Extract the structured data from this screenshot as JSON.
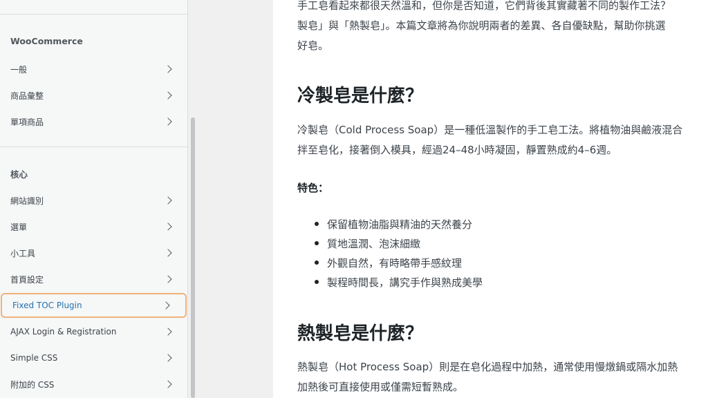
{
  "sidebar": {
    "section_woocommerce": "WooCommerce",
    "woocommerce_items": [
      {
        "label": "一般"
      },
      {
        "label": "商品彙整"
      },
      {
        "label": "單項商品"
      }
    ],
    "section_core": "核心",
    "core_items": [
      {
        "label": "網站識別"
      },
      {
        "label": "選單"
      },
      {
        "label": "小工具"
      },
      {
        "label": "首頁設定"
      },
      {
        "label": "Fixed TOC Plugin"
      },
      {
        "label": "AJAX Login & Registration"
      },
      {
        "label": "Simple CSS"
      },
      {
        "label": "附加的 CSS"
      }
    ]
  },
  "article": {
    "intro_line1": "手工皂看起來都很天然溫和，但你是否知道，它們背後其實藏著不同的製作工法？",
    "intro_line2": "製皂」與「熱製皂」。本篇文章將為你說明兩者的差異、各自優缺點，幫助你挑選",
    "intro_line3": "好皂。",
    "h2_cold": "冷製皂是什麼？",
    "cold_line1": "冷製皂（Cold Process Soap）是一種低溫製作的手工皂工法。將植物油與鹼液混合",
    "cold_line2": "拌至皂化，接著倒入模具，經過24–48小時凝固，靜置熟成約4–6週。",
    "features_label": "特色：",
    "features": [
      "保留植物油脂與精油的天然養分",
      "質地溫潤、泡沫細緻",
      "外觀自然，有時略帶手感紋理",
      "製程時間長，講究手作與熟成美學"
    ],
    "h2_hot": "熱製皂是什麼？",
    "hot_line1": "熱製皂（Hot Process Soap）則是在皂化過程中加熱，通常使用慢燉鍋或隔水加熱",
    "hot_line2": "加熱後可直接使用或僅需短暫熟成。"
  }
}
